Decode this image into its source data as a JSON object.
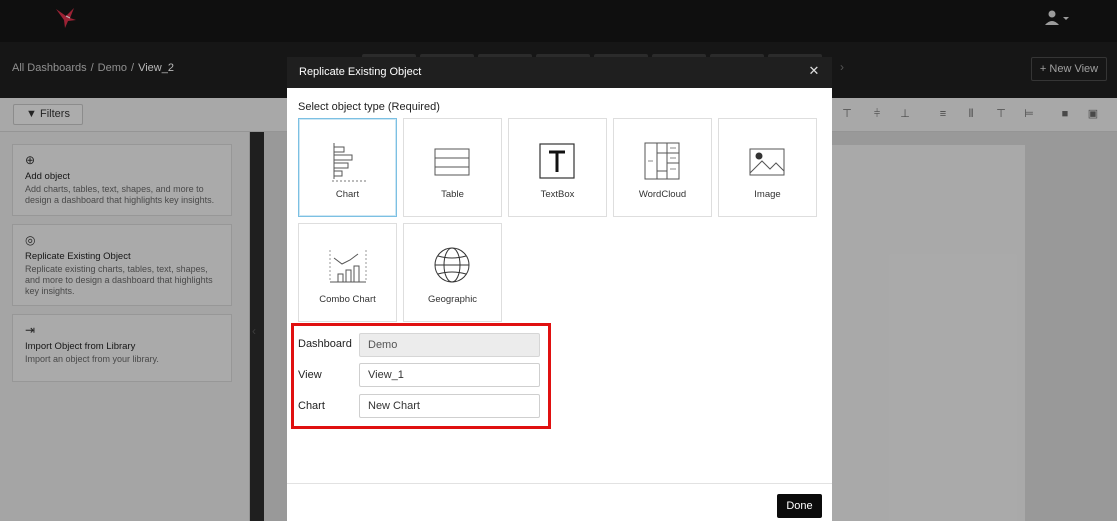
{
  "header": {
    "logo_icon": "hummingbird-logo-icon",
    "user_icon": "user-icon"
  },
  "subheader": {
    "breadcrumb": [
      "All Dashboards",
      "Demo",
      "View_2"
    ],
    "breadcrumb_separator": "/",
    "new_view_label": "+ New View"
  },
  "toolbar": {
    "filters_label": "Filters"
  },
  "sidebar": {
    "cards": [
      {
        "icon": "plus-circle-icon",
        "glyph": "⊕",
        "title": "Add object",
        "desc": "Add charts, tables, text, shapes, and more to design a dashboard that highlights key insights."
      },
      {
        "icon": "replicate-icon",
        "glyph": "◎",
        "title": "Replicate Existing Object",
        "desc": "Replicate existing charts, tables, text, shapes, and more to design a dashboard that highlights key insights."
      },
      {
        "icon": "import-icon",
        "glyph": "⇥",
        "title": "Import Object from Library",
        "desc": "Import an object from your library."
      }
    ]
  },
  "modal": {
    "title": "Replicate Existing Object",
    "close_glyph": "✕",
    "select_label": "Select object type (Required)",
    "types": [
      {
        "label": "Chart",
        "icon": "chart-icon",
        "selected": true
      },
      {
        "label": "Table",
        "icon": "table-icon",
        "selected": false
      },
      {
        "label": "TextBox",
        "icon": "textbox-icon",
        "selected": false
      },
      {
        "label": "WordCloud",
        "icon": "wordcloud-icon",
        "selected": false
      },
      {
        "label": "Image",
        "icon": "image-icon",
        "selected": false
      },
      {
        "label": "Combo Chart",
        "icon": "combo-chart-icon",
        "selected": false
      },
      {
        "label": "Geographic",
        "icon": "globe-icon",
        "selected": false
      }
    ],
    "form": {
      "dashboard_label": "Dashboard",
      "dashboard_value": "Demo",
      "view_label": "View",
      "view_value": "View_1",
      "chart_label": "Chart",
      "chart_value": "New Chart"
    },
    "done_label": "Done"
  },
  "colors": {
    "highlight": "#e01010",
    "selected_border": "#7cc0e3",
    "header_bg": "#1f1f1f"
  }
}
